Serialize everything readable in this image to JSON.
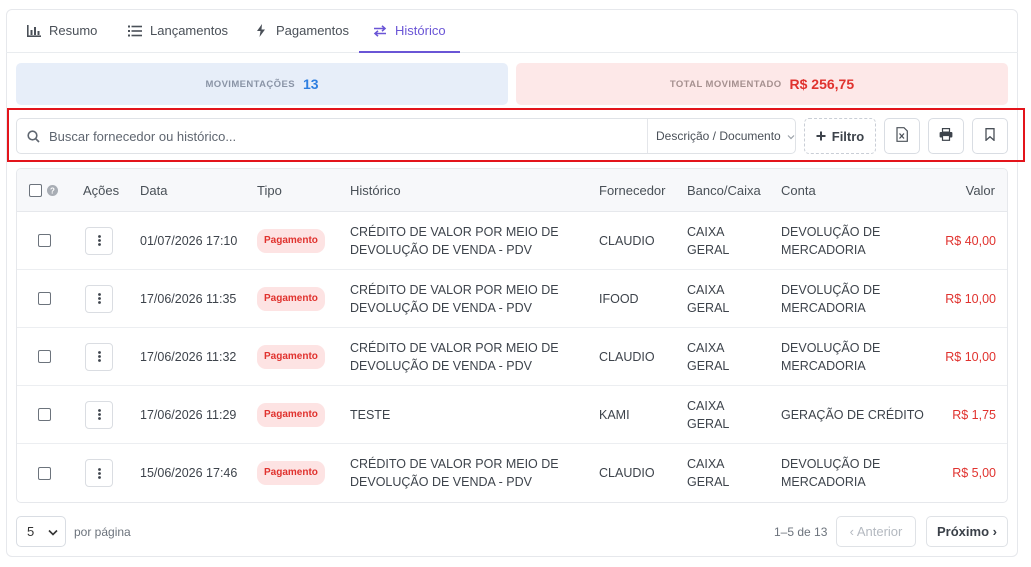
{
  "tabs": [
    {
      "label": "Resumo",
      "icon": "bar-chart-icon"
    },
    {
      "label": "Lançamentos",
      "icon": "list-icon"
    },
    {
      "label": "Pagamentos",
      "icon": "bolt-icon"
    },
    {
      "label": "Histórico",
      "icon": "swap-arrows-icon"
    }
  ],
  "active_tab": "Histórico",
  "stats": {
    "movimentacoes_label": "MOVIMENTAÇÕES",
    "movimentacoes_value": "13",
    "total_label": "TOTAL MOVIMENTADO",
    "total_value": "R$ 256,75"
  },
  "search": {
    "placeholder": "Buscar fornecedor ou histórico...",
    "value": "",
    "field_select": "Descrição / Documento"
  },
  "toolbar": {
    "filter_label": "Filtro"
  },
  "table": {
    "headers": {
      "actions": "Ações",
      "date": "Data",
      "type": "Tipo",
      "history": "Histórico",
      "supplier": "Fornecedor",
      "bank": "Banco/Caixa",
      "account": "Conta",
      "value": "Valor"
    },
    "rows": [
      {
        "date": "01/07/2026 17:10",
        "type": "Pagamento",
        "history_1": "CRÉDITO DE VALOR POR MEIO DE",
        "history_2": "DEVOLUÇÃO DE VENDA - PDV",
        "supplier": "CLAUDIO",
        "bank_1": "CAIXA",
        "bank_2": "GERAL",
        "account_1": "DEVOLUÇÃO DE",
        "account_2": "MERCADORIA",
        "value": "R$ 40,00"
      },
      {
        "date": "17/06/2026 11:35",
        "type": "Pagamento",
        "history_1": "CRÉDITO DE VALOR POR MEIO DE",
        "history_2": "DEVOLUÇÃO DE VENDA - PDV",
        "supplier": "IFOOD",
        "bank_1": "CAIXA",
        "bank_2": "GERAL",
        "account_1": "DEVOLUÇÃO DE",
        "account_2": "MERCADORIA",
        "value": "R$ 10,00"
      },
      {
        "date": "17/06/2026 11:32",
        "type": "Pagamento",
        "history_1": "CRÉDITO DE VALOR POR MEIO DE",
        "history_2": "DEVOLUÇÃO DE VENDA - PDV",
        "supplier": "CLAUDIO",
        "bank_1": "CAIXA",
        "bank_2": "GERAL",
        "account_1": "DEVOLUÇÃO DE",
        "account_2": "MERCADORIA",
        "value": "R$ 10,00"
      },
      {
        "date": "17/06/2026 11:29",
        "type": "Pagamento",
        "history_1": "TESTE",
        "history_2": "",
        "supplier": "KAMI",
        "bank_1": "CAIXA",
        "bank_2": "GERAL",
        "account_1": "GERAÇÃO DE CRÉDITO",
        "account_2": "",
        "value": "R$ 1,75"
      },
      {
        "date": "15/06/2026 17:46",
        "type": "Pagamento",
        "history_1": "CRÉDITO DE VALOR POR MEIO DE",
        "history_2": "DEVOLUÇÃO DE VENDA - PDV",
        "supplier": "CLAUDIO",
        "bank_1": "CAIXA",
        "bank_2": "GERAL",
        "account_1": "DEVOLUÇÃO DE",
        "account_2": "MERCADORIA",
        "value": "R$ 5,00"
      }
    ]
  },
  "pagination": {
    "per_page_value": "5",
    "per_page_label": "por página",
    "range": "1–5 de 13",
    "prev_label": "‹ Anterior",
    "next_label": "Próximo ›"
  },
  "colors": {
    "accent": "#6a55d6",
    "danger": "#e0322e",
    "info": "#2f7fe0"
  }
}
